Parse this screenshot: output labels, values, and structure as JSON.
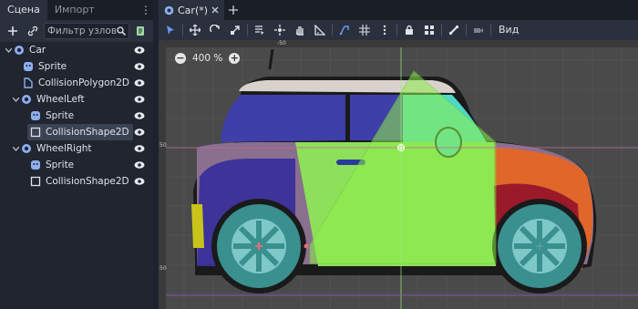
{
  "dock": {
    "tabs": [
      "Сцена",
      "Импорт"
    ],
    "menu_icon": "kebab-icon",
    "filter_placeholder": "Фильтр узлов",
    "tree": [
      {
        "label": "Car",
        "icon": "node2d-icon",
        "depth": 0,
        "expanded": true
      },
      {
        "label": "Sprite",
        "icon": "sprite-icon",
        "depth": 1
      },
      {
        "label": "CollisionPolygon2D",
        "icon": "collision-polygon-icon",
        "depth": 1
      },
      {
        "label": "WheelLeft",
        "icon": "node2d-icon",
        "depth": 1,
        "expanded": true
      },
      {
        "label": "Sprite",
        "icon": "sprite-icon",
        "depth": 2
      },
      {
        "label": "CollisionShape2D",
        "icon": "collision-shape-icon",
        "depth": 2,
        "selected": true
      },
      {
        "label": "WheelRight",
        "icon": "node2d-icon",
        "depth": 1,
        "expanded": true
      },
      {
        "label": "Sprite",
        "icon": "sprite-icon",
        "depth": 2
      },
      {
        "label": "CollisionShape2D",
        "icon": "collision-shape-icon",
        "depth": 2
      }
    ]
  },
  "editor": {
    "tab_label": "Car(*)",
    "view_label": "Вид",
    "zoom_label": "400 %",
    "ruler_labels": {
      "top": "-50",
      "left_top": "50",
      "left_bottom": "50"
    }
  },
  "colors": {
    "accent": "#6b9bf0",
    "selection_row": "#3b4252",
    "collision_fill": "#8ef04a",
    "viewport_bg": "#4a4a4a"
  }
}
